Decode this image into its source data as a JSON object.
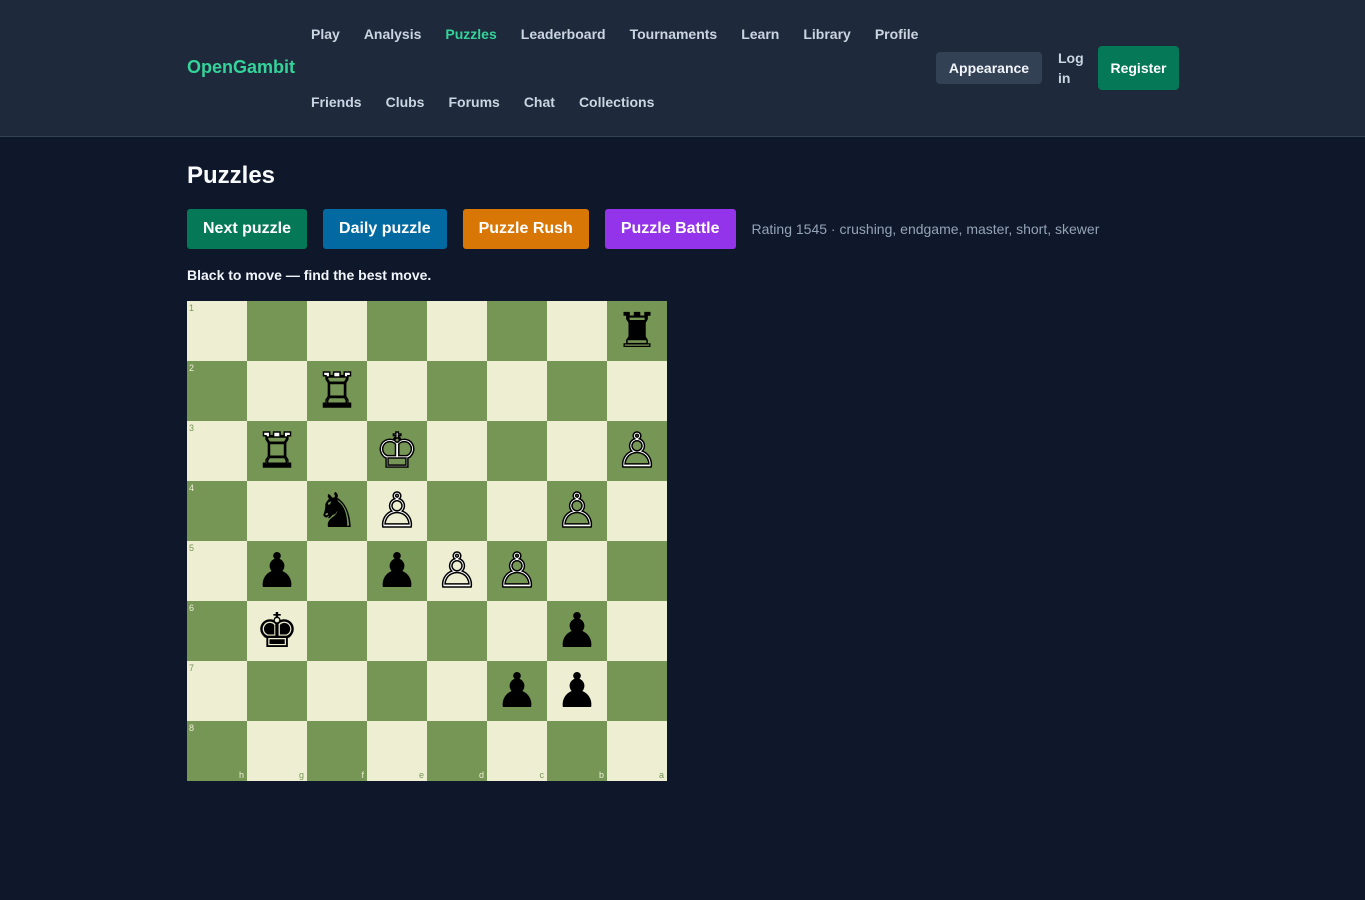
{
  "brand": "OpenGambit",
  "nav": {
    "row1": [
      {
        "label": "Play",
        "active": false
      },
      {
        "label": "Analysis",
        "active": false
      },
      {
        "label": "Puzzles",
        "active": true
      },
      {
        "label": "Leaderboard",
        "active": false
      },
      {
        "label": "Tournaments",
        "active": false
      },
      {
        "label": "Learn",
        "active": false
      },
      {
        "label": "Library",
        "active": false
      },
      {
        "label": "Profile",
        "active": false
      }
    ],
    "row2": [
      {
        "label": "Friends",
        "active": false
      },
      {
        "label": "Clubs",
        "active": false
      },
      {
        "label": "Forums",
        "active": false
      },
      {
        "label": "Chat",
        "active": false
      },
      {
        "label": "Collections",
        "active": false
      }
    ]
  },
  "header_actions": {
    "appearance": "Appearance",
    "login": "Log in",
    "register": "Register"
  },
  "page_title": "Puzzles",
  "actions": [
    {
      "name": "next-puzzle-button",
      "label": "Next puzzle",
      "color": "#047857"
    },
    {
      "name": "daily-puzzle-button",
      "label": "Daily puzzle",
      "color": "#0369a1"
    },
    {
      "name": "puzzle-rush-button",
      "label": "Puzzle Rush",
      "color": "#d97706"
    },
    {
      "name": "puzzle-battle-button",
      "label": "Puzzle Battle",
      "color": "#9333ea"
    }
  ],
  "puzzle_meta": "Rating 1545 · crushing, endgame, master, short, skewer",
  "prompt": "Black to move — find the best move.",
  "colors": {
    "light_square": "#eeeed2",
    "dark_square": "#769656",
    "accent": "#34d399"
  },
  "board": {
    "orientation": "black",
    "ranks_top_to_bottom": [
      "1",
      "2",
      "3",
      "4",
      "5",
      "6",
      "7",
      "8"
    ],
    "files_left_to_right": [
      "h",
      "g",
      "f",
      "e",
      "d",
      "c",
      "b",
      "a"
    ],
    "rows": [
      [
        "",
        "",
        "",
        "",
        "",
        "",
        "",
        "r"
      ],
      [
        "",
        "",
        "R",
        "",
        "",
        "",
        "",
        ""
      ],
      [
        "",
        "R",
        "",
        "K",
        "",
        "",
        "",
        "P"
      ],
      [
        "",
        "",
        "n",
        "P",
        "",
        "",
        "P",
        ""
      ],
      [
        "",
        "p",
        "",
        "p",
        "P",
        "P",
        "",
        ""
      ],
      [
        "",
        "k",
        "",
        "",
        "",
        "",
        "p",
        ""
      ],
      [
        "",
        "",
        "",
        "",
        "",
        "p",
        "p",
        ""
      ],
      [
        "",
        "",
        "",
        "",
        "",
        "",
        "",
        ""
      ]
    ]
  }
}
